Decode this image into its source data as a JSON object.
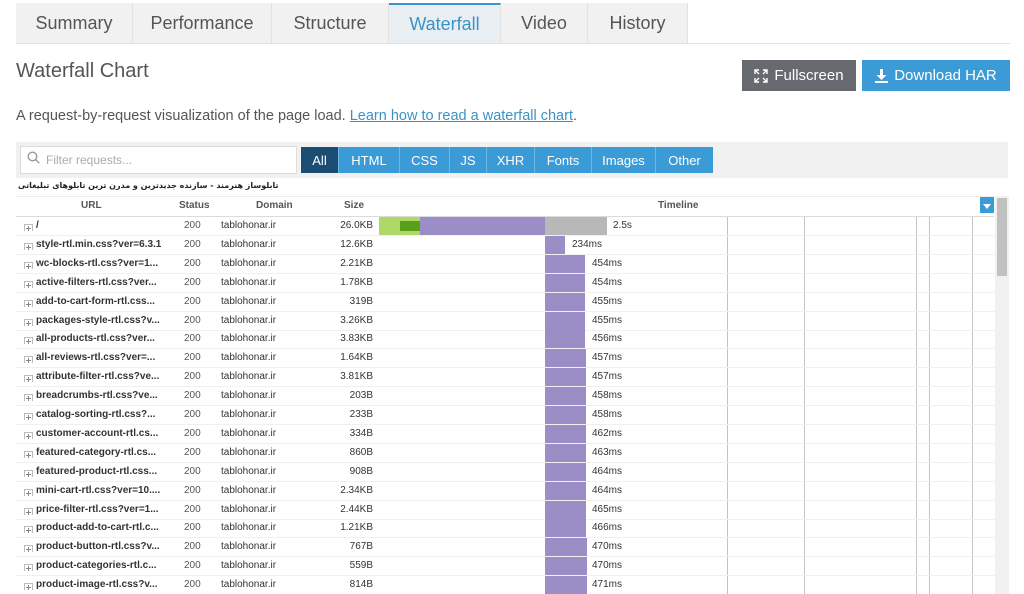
{
  "tabs": [
    {
      "label": "Summary",
      "active": false
    },
    {
      "label": "Performance",
      "active": false
    },
    {
      "label": "Structure",
      "active": false
    },
    {
      "label": "Waterfall",
      "active": true
    },
    {
      "label": "Video",
      "active": false
    },
    {
      "label": "History",
      "active": false
    }
  ],
  "page_title": "Waterfall Chart",
  "buttons": {
    "fullscreen": "Fullscreen",
    "download": "Download HAR"
  },
  "description": {
    "text": "A request-by-request visualization of the page load. ",
    "link": "Learn how to read a waterfall chart",
    "end": "."
  },
  "search": {
    "placeholder": "Filter requests..."
  },
  "filters": [
    {
      "label": "All",
      "active": true
    },
    {
      "label": "HTML",
      "active": false
    },
    {
      "label": "CSS",
      "active": false
    },
    {
      "label": "JS",
      "active": false
    },
    {
      "label": "XHR",
      "active": false
    },
    {
      "label": "Fonts",
      "active": false
    },
    {
      "label": "Images",
      "active": false
    },
    {
      "label": "Other",
      "active": false
    }
  ],
  "page_name": "تابلوساز هنرمند - سازنده جدیدترین و مدرن ترین تابلوهای تبلیغاتی",
  "columns": {
    "url": "URL",
    "status": "Status",
    "domain": "Domain",
    "size": "Size",
    "timeline": "Timeline"
  },
  "colors": {
    "accent": "#3a9bd6",
    "blocking": "#b0d866",
    "dns": "#5a9e1a",
    "waiting": "#9b8ec7",
    "receiving": "#b8b8b8"
  },
  "requests": [
    {
      "url": "/",
      "status": "200",
      "domain": "tablohonar.ir",
      "size": "26.0KB",
      "time": "2.5s"
    },
    {
      "url": "style-rtl.min.css?ver=6.3.1",
      "status": "200",
      "domain": "tablohonar.ir",
      "size": "12.6KB",
      "time": "234ms"
    },
    {
      "url": "wc-blocks-rtl.css?ver=1...",
      "status": "200",
      "domain": "tablohonar.ir",
      "size": "2.21KB",
      "time": "454ms"
    },
    {
      "url": "active-filters-rtl.css?ver...",
      "status": "200",
      "domain": "tablohonar.ir",
      "size": "1.78KB",
      "time": "454ms"
    },
    {
      "url": "add-to-cart-form-rtl.css...",
      "status": "200",
      "domain": "tablohonar.ir",
      "size": "319B",
      "time": "455ms"
    },
    {
      "url": "packages-style-rtl.css?v...",
      "status": "200",
      "domain": "tablohonar.ir",
      "size": "3.26KB",
      "time": "455ms"
    },
    {
      "url": "all-products-rtl.css?ver...",
      "status": "200",
      "domain": "tablohonar.ir",
      "size": "3.83KB",
      "time": "456ms"
    },
    {
      "url": "all-reviews-rtl.css?ver=...",
      "status": "200",
      "domain": "tablohonar.ir",
      "size": "1.64KB",
      "time": "457ms"
    },
    {
      "url": "attribute-filter-rtl.css?ve...",
      "status": "200",
      "domain": "tablohonar.ir",
      "size": "3.81KB",
      "time": "457ms"
    },
    {
      "url": "breadcrumbs-rtl.css?ve...",
      "status": "200",
      "domain": "tablohonar.ir",
      "size": "203B",
      "time": "458ms"
    },
    {
      "url": "catalog-sorting-rtl.css?...",
      "status": "200",
      "domain": "tablohonar.ir",
      "size": "233B",
      "time": "458ms"
    },
    {
      "url": "customer-account-rtl.cs...",
      "status": "200",
      "domain": "tablohonar.ir",
      "size": "334B",
      "time": "462ms"
    },
    {
      "url": "featured-category-rtl.cs...",
      "status": "200",
      "domain": "tablohonar.ir",
      "size": "860B",
      "time": "463ms"
    },
    {
      "url": "featured-product-rtl.css...",
      "status": "200",
      "domain": "tablohonar.ir",
      "size": "908B",
      "time": "464ms"
    },
    {
      "url": "mini-cart-rtl.css?ver=10....",
      "status": "200",
      "domain": "tablohonar.ir",
      "size": "2.34KB",
      "time": "464ms"
    },
    {
      "url": "price-filter-rtl.css?ver=1...",
      "status": "200",
      "domain": "tablohonar.ir",
      "size": "2.44KB",
      "time": "465ms"
    },
    {
      "url": "product-add-to-cart-rtl.c...",
      "status": "200",
      "domain": "tablohonar.ir",
      "size": "1.21KB",
      "time": "466ms"
    },
    {
      "url": "product-button-rtl.css?v...",
      "status": "200",
      "domain": "tablohonar.ir",
      "size": "767B",
      "time": "470ms"
    },
    {
      "url": "product-categories-rtl.c...",
      "status": "200",
      "domain": "tablohonar.ir",
      "size": "559B",
      "time": "470ms"
    },
    {
      "url": "product-image-rtl.css?v...",
      "status": "200",
      "domain": "tablohonar.ir",
      "size": "814B",
      "time": "471ms"
    }
  ]
}
